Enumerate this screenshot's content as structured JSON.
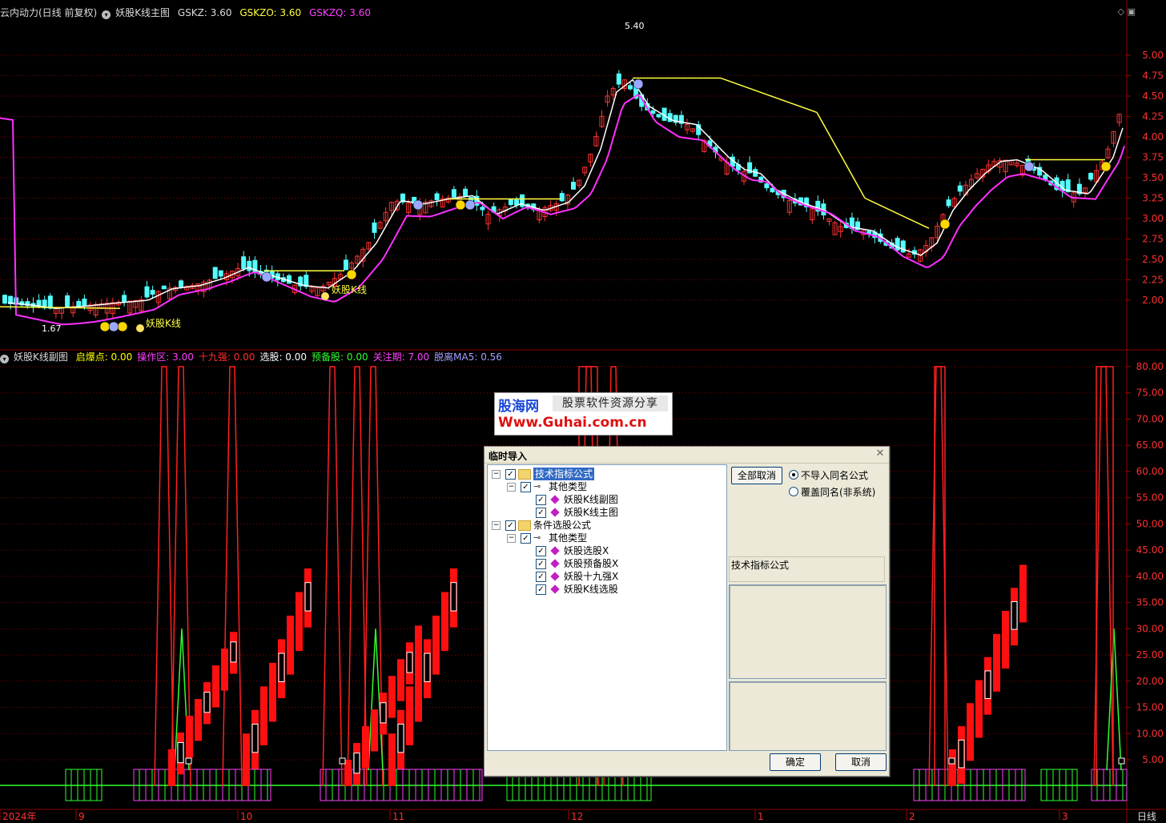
{
  "top_header": {
    "stock_name": "云内动力(日线 前复权)",
    "indicator": "妖股K线主图",
    "gskz": "GSKZ: 3.60",
    "gskzo": "GSKZO: 3.60",
    "gskzq": "GSKZQ: 3.60"
  },
  "sub_header": {
    "indicator": "妖股K线副图",
    "items": [
      {
        "text": "启爆点: 0.00",
        "color": "#ffff00"
      },
      {
        "text": "操作区: 3.00",
        "color": "#ff40ff"
      },
      {
        "text": "十九强: 0.00",
        "color": "#ff3030"
      },
      {
        "text": "选股: 0.00",
        "color": "#ffffff"
      },
      {
        "text": "预备股: 0.00",
        "color": "#30ff30"
      },
      {
        "text": "关注期: 7.00",
        "color": "#ff40ff"
      },
      {
        "text": "脱离MA5: 0.56",
        "color": "#a0a0ff"
      }
    ]
  },
  "price_axis": [
    "5.00",
    "4.75",
    "4.50",
    "4.25",
    "4.00",
    "3.75",
    "3.50",
    "3.25",
    "3.00",
    "2.75",
    "2.50",
    "2.25",
    "2.00"
  ],
  "sub_axis": [
    "80.00",
    "75.00",
    "70.00",
    "65.00",
    "60.00",
    "55.00",
    "50.00",
    "45.00",
    "40.00",
    "35.00",
    "30.00",
    "25.00",
    "20.00",
    "15.00",
    "10.00",
    "5.00"
  ],
  "date_axis": [
    "2024年",
    "9",
    "10",
    "11",
    "12",
    "1",
    "2",
    "3"
  ],
  "period_label": "日线",
  "annotations": {
    "high_label": "5.40",
    "low_label": "1.67",
    "signal_label_1": "妖股K线",
    "signal_label_2": "妖股K线"
  },
  "watermark": {
    "brand": "股海网",
    "slogan": "股票软件资源分享",
    "url": "Www.Guhai.com.cn"
  },
  "dialog": {
    "title": "临时导入",
    "tree": [
      {
        "label": "技术指标公式",
        "selected": true
      },
      {
        "label": "其他类型"
      },
      {
        "label": "妖股K线副图"
      },
      {
        "label": "妖股K线主图"
      },
      {
        "label": "条件选股公式"
      },
      {
        "label": "其他类型"
      },
      {
        "label": "妖股选股X"
      },
      {
        "label": "妖股预备股X"
      },
      {
        "label": "妖股十九强X"
      },
      {
        "label": "妖股K线选股"
      }
    ],
    "cancel_all": "全部取消",
    "radio_skip": "不导入同名公式",
    "radio_overwrite": "覆盖同名(非系统)",
    "description": "技术指标公式",
    "ok": "确定",
    "cancel": "取消"
  },
  "colors": {
    "up_candle": "#ff3232",
    "down_candle": "#54ffff",
    "ma_white": "#ffffff",
    "ma_magenta": "#ff30ff",
    "ma_yellow": "#ffff40",
    "grid": "#8b0000"
  }
}
